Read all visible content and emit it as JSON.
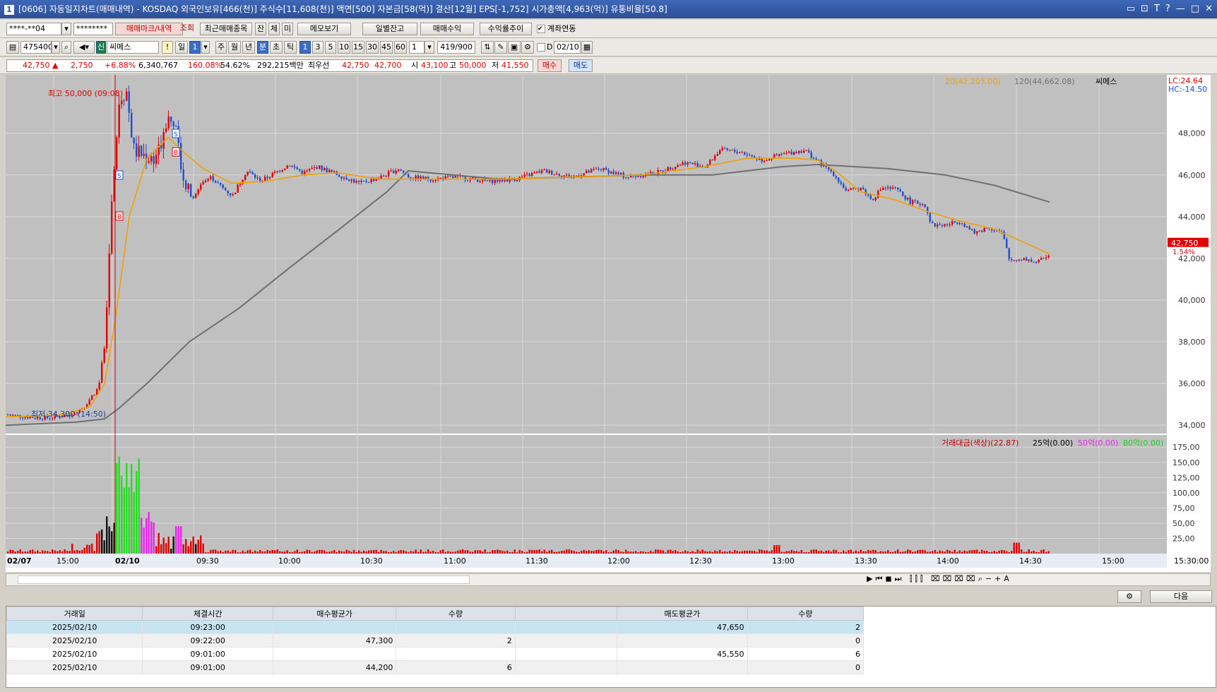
{
  "window": {
    "title": "[0606] 자동일지차트(매매내역) - KOSDAQ 외국인보유[466(천)] 주식수[11,608(천)] 액면[500] 자본금[58(억)] 결산[12월] EPS[-1,752] 시가총액[4,963(억)] 유통비율[50.8]",
    "num": "1",
    "controls": [
      "▭",
      "⊡",
      "T",
      "?",
      "—",
      "□",
      "✕"
    ]
  },
  "toolbar1": {
    "account": "****-**04",
    "password": "********",
    "btn_mark": "매매마크/내역",
    "btn_query": "조회",
    "btn_recent": "최근매매종목",
    "btn_jan": "잔",
    "btn_che": "체",
    "btn_mi": "미",
    "btn_memo": "메모보기",
    "btn_daily": "일별잔고",
    "btn_profit": "매매수익",
    "btn_return": "수익률추이",
    "check_label": "계좌연동"
  },
  "toolbar2": {
    "code": "475400",
    "badge": "신",
    "stock_name": "씨메스",
    "excl": "!",
    "il": "일",
    "il_val": "1",
    "ju": "주",
    "wol": "월",
    "nyeon": "년",
    "bun": "분",
    "cho": "초",
    "tik": "틱",
    "periods": [
      "1",
      "3",
      "5",
      "10",
      "15",
      "30",
      "45",
      "60"
    ],
    "period_sel": "1",
    "count": "419/900",
    "d": "D",
    "date": "02/10"
  },
  "quote": {
    "price": "42,750",
    "arrow": "▲",
    "change": "2,750",
    "pct": "+6.88%",
    "volume": "6,340,767",
    "vol_ratio": "160.08%",
    "turn": "54.62%",
    "amount": "292,215백만",
    "bestlabel": "최우선",
    "best_ask": "42,750",
    "best_bid": "42,700",
    "open_label": "시",
    "open": "43,100",
    "high_label": "고",
    "high": "50,000",
    "low_label": "저",
    "low": "41,550",
    "buy": "매수",
    "sell": "매도"
  },
  "chart_data": [
    {
      "type": "candlestick",
      "legend": {
        "ma20": "20(42,205.00)",
        "ma120": "120(44,662.08)",
        "name": "씨메스"
      },
      "lc": "LC:24.64",
      "hc": "HC:-14.50",
      "y_ticks": [
        48000,
        46000,
        44000,
        42000,
        40000,
        38000,
        36000,
        34000
      ],
      "y_tick_labels": [
        "48,000",
        "46,000",
        "44,000",
        "42,000",
        "40,000",
        "38,000",
        "36,000",
        "34,000"
      ],
      "ylim": [
        33600,
        50800
      ],
      "x_labels": [
        "02/07",
        "15:00",
        "02/10",
        "09:30",
        "10:00",
        "10:30",
        "11:00",
        "11:30",
        "12:00",
        "12:30",
        "13:00",
        "13:30",
        "14:00",
        "14:30",
        "15:00",
        "15:30:00"
      ],
      "high_note": "최고 50,000 (09:08)",
      "low_note": "최저 34,300 (14:50)",
      "last_price": "42,750",
      "last_pct": "1.54%",
      "close_path": [
        [
          0,
          34500
        ],
        [
          30,
          34400
        ],
        [
          60,
          34350
        ],
        [
          90,
          34500
        ],
        [
          110,
          34900
        ],
        [
          130,
          35800
        ],
        [
          140,
          38000
        ],
        [
          145,
          42000
        ],
        [
          152,
          46000
        ],
        [
          160,
          49800
        ],
        [
          170,
          50000
        ],
        [
          180,
          47200
        ],
        [
          190,
          47000
        ],
        [
          205,
          46800
        ],
        [
          215,
          47000
        ],
        [
          225,
          48600
        ],
        [
          235,
          49000
        ],
        [
          245,
          47000
        ],
        [
          255,
          45300
        ],
        [
          265,
          44800
        ],
        [
          275,
          45600
        ],
        [
          290,
          45900
        ],
        [
          305,
          45400
        ],
        [
          320,
          45000
        ],
        [
          340,
          46200
        ],
        [
          360,
          45700
        ],
        [
          380,
          46100
        ],
        [
          400,
          46500
        ],
        [
          420,
          46100
        ],
        [
          440,
          46400
        ],
        [
          470,
          46000
        ],
        [
          500,
          45600
        ],
        [
          530,
          45900
        ],
        [
          555,
          46300
        ],
        [
          570,
          45900
        ],
        [
          600,
          45800
        ],
        [
          640,
          45900
        ],
        [
          680,
          45700
        ],
        [
          720,
          45800
        ],
        [
          760,
          46200
        ],
        [
          800,
          45900
        ],
        [
          840,
          46300
        ],
        [
          880,
          45900
        ],
        [
          920,
          46100
        ],
        [
          960,
          46600
        ],
        [
          990,
          46400
        ],
        [
          1010,
          47200
        ],
        [
          1040,
          47100
        ],
        [
          1070,
          46700
        ],
        [
          1100,
          47000
        ],
        [
          1130,
          47200
        ],
        [
          1150,
          46600
        ],
        [
          1170,
          46100
        ],
        [
          1190,
          45200
        ],
        [
          1210,
          45400
        ],
        [
          1225,
          44800
        ],
        [
          1240,
          45400
        ],
        [
          1260,
          45300
        ],
        [
          1280,
          44700
        ],
        [
          1300,
          44600
        ],
        [
          1310,
          43600
        ],
        [
          1330,
          43600
        ],
        [
          1350,
          43800
        ],
        [
          1370,
          43200
        ],
        [
          1390,
          43500
        ],
        [
          1410,
          43200
        ],
        [
          1420,
          41900
        ],
        [
          1440,
          42000
        ],
        [
          1460,
          41800
        ],
        [
          1475,
          42200
        ]
      ],
      "ma20_path": [
        [
          0,
          34400
        ],
        [
          80,
          34500
        ],
        [
          120,
          34900
        ],
        [
          140,
          36000
        ],
        [
          155,
          39000
        ],
        [
          175,
          44000
        ],
        [
          200,
          46800
        ],
        [
          230,
          47800
        ],
        [
          255,
          47000
        ],
        [
          280,
          46300
        ],
        [
          320,
          45600
        ],
        [
          370,
          45700
        ],
        [
          420,
          46000
        ],
        [
          470,
          46100
        ],
        [
          530,
          45800
        ],
        [
          600,
          45800
        ],
        [
          700,
          45800
        ],
        [
          800,
          45900
        ],
        [
          900,
          46000
        ],
        [
          990,
          46400
        ],
        [
          1050,
          46800
        ],
        [
          1120,
          46800
        ],
        [
          1150,
          46700
        ],
        [
          1175,
          46200
        ],
        [
          1210,
          45200
        ],
        [
          1260,
          44800
        ],
        [
          1300,
          44300
        ],
        [
          1350,
          43800
        ],
        [
          1400,
          43400
        ],
        [
          1440,
          42800
        ],
        [
          1478,
          42200
        ]
      ],
      "ma120_path": [
        [
          0,
          34000
        ],
        [
          100,
          34150
        ],
        [
          140,
          34300
        ],
        [
          160,
          34800
        ],
        [
          200,
          36000
        ],
        [
          260,
          38000
        ],
        [
          330,
          39600
        ],
        [
          400,
          41500
        ],
        [
          480,
          43600
        ],
        [
          540,
          45200
        ],
        [
          570,
          46200
        ],
        [
          600,
          46100
        ],
        [
          700,
          45800
        ],
        [
          800,
          45900
        ],
        [
          900,
          46000
        ],
        [
          1000,
          46000
        ],
        [
          1100,
          46400
        ],
        [
          1150,
          46500
        ],
        [
          1250,
          46300
        ],
        [
          1330,
          46000
        ],
        [
          1400,
          45500
        ],
        [
          1478,
          44700
        ]
      ]
    },
    {
      "type": "bar",
      "legend": {
        "main": "거래대금(색상)(22.87)",
        "l25": "25억(0.00)",
        "l50": "50억(0.00)",
        "l80": "80억(0.00)"
      },
      "y_ticks": [
        25,
        50,
        75,
        100,
        125,
        150,
        175
      ],
      "y_tick_labels": [
        "25,00",
        "50,00",
        "75,00",
        "100,00",
        "125,00",
        "150,00",
        "175,00"
      ],
      "ylim": [
        0,
        195
      ]
    }
  ],
  "bottom": {
    "next": "다음"
  },
  "table": {
    "headers": [
      "거래일",
      "체결시간",
      "매수평균가",
      "수량",
      "",
      "매도평균가",
      "수량"
    ],
    "rows": [
      [
        "2025/02/10",
        "09:23:00",
        "",
        "",
        "",
        "47,650",
        "2"
      ],
      [
        "2025/02/10",
        "09:22:00",
        "47,300",
        "2",
        "",
        "",
        "0"
      ],
      [
        "2025/02/10",
        "09:01:00",
        "",
        "",
        "",
        "45,550",
        "6"
      ],
      [
        "2025/02/10",
        "09:01:00",
        "44,200",
        "6",
        "",
        "",
        "0"
      ]
    ]
  },
  "colors": {
    "up": "#e00000",
    "down": "#1f4fd0",
    "ma20": "#f0a000",
    "ma120": "#707070",
    "green": "#22dd22",
    "magenta": "#ee22ee"
  }
}
